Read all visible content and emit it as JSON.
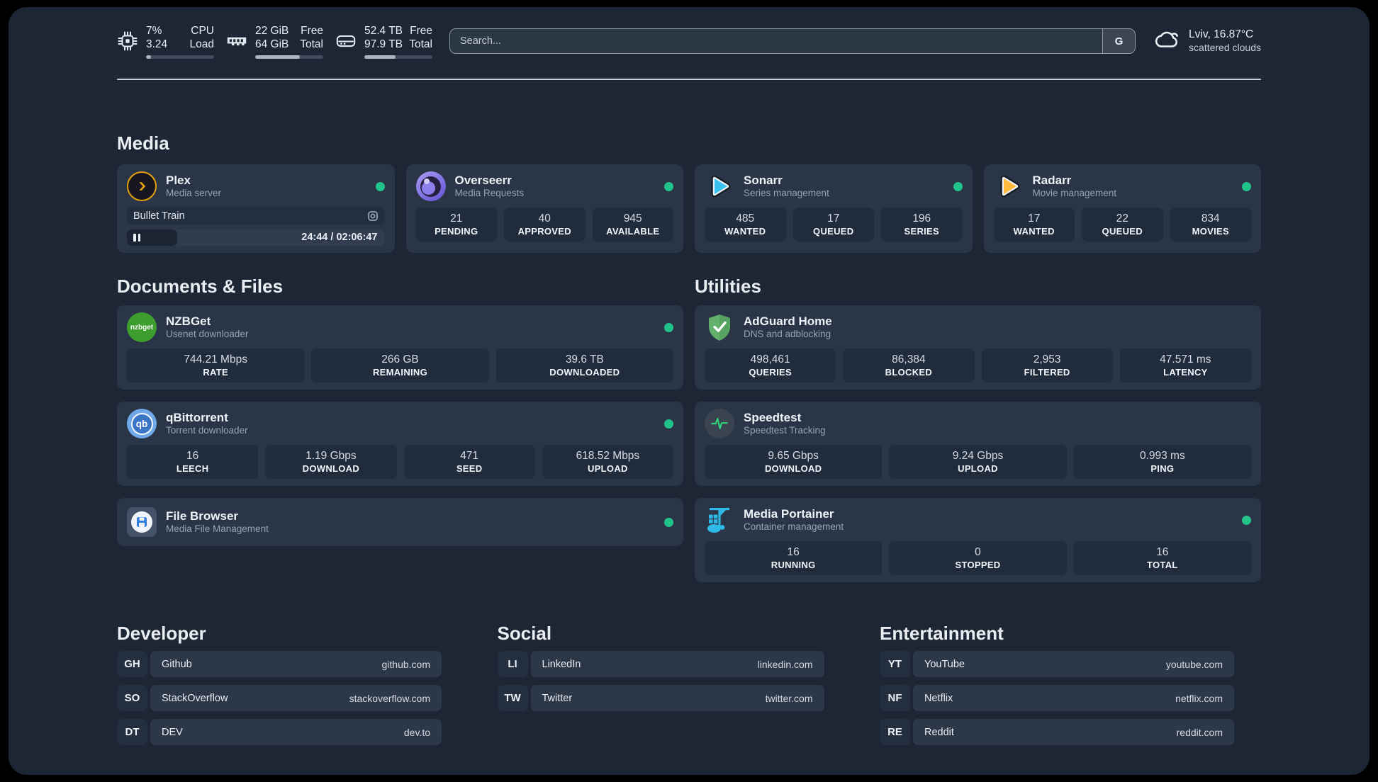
{
  "header": {
    "metrics": [
      {
        "name": "cpu",
        "icon": "cpu-icon",
        "rows": [
          [
            "7%",
            "CPU"
          ],
          [
            "3.24",
            "Load"
          ]
        ],
        "progress_pct": 7
      },
      {
        "name": "memory",
        "icon": "ram-icon",
        "rows": [
          [
            "22 GiB",
            "Free"
          ],
          [
            "64 GiB",
            "Total"
          ]
        ],
        "progress_pct": 66
      },
      {
        "name": "storage",
        "icon": "disk-icon",
        "rows": [
          [
            "52.4 TB",
            "Free"
          ],
          [
            "97.9 TB",
            "Total"
          ]
        ],
        "progress_pct": 46
      }
    ],
    "search": {
      "placeholder": "Search...",
      "engine_label": "G"
    },
    "weather": {
      "line1": "Lviv, 16.87°C",
      "line2": "scattered clouds"
    }
  },
  "sections": {
    "media": {
      "title": "Media"
    },
    "documents": {
      "title": "Documents & Files"
    },
    "utilities": {
      "title": "Utilities"
    },
    "developer": {
      "title": "Developer"
    },
    "social": {
      "title": "Social"
    },
    "entertainment": {
      "title": "Entertainment"
    }
  },
  "apps": {
    "plex": {
      "name": "Plex",
      "subtitle": "Media server",
      "online": true,
      "now_playing": {
        "title": "Bullet Train",
        "time": "24:44 / 02:06:47",
        "progress_pct": 19.5
      }
    },
    "overseerr": {
      "name": "Overseerr",
      "subtitle": "Media Requests",
      "online": true,
      "stats": [
        {
          "value": "21",
          "label": "PENDING"
        },
        {
          "value": "40",
          "label": "APPROVED"
        },
        {
          "value": "945",
          "label": "AVAILABLE"
        }
      ]
    },
    "sonarr": {
      "name": "Sonarr",
      "subtitle": "Series management",
      "online": true,
      "stats": [
        {
          "value": "485",
          "label": "WANTED"
        },
        {
          "value": "17",
          "label": "QUEUED"
        },
        {
          "value": "196",
          "label": "SERIES"
        }
      ]
    },
    "radarr": {
      "name": "Radarr",
      "subtitle": "Movie management",
      "online": true,
      "stats": [
        {
          "value": "17",
          "label": "WANTED"
        },
        {
          "value": "22",
          "label": "QUEUED"
        },
        {
          "value": "834",
          "label": "MOVIES"
        }
      ]
    },
    "nzbget": {
      "name": "NZBGet",
      "subtitle": "Usenet downloader",
      "online": true,
      "icon_text": "nzbget",
      "stats": [
        {
          "value": "744.21 Mbps",
          "label": "RATE"
        },
        {
          "value": "266 GB",
          "label": "REMAINING"
        },
        {
          "value": "39.6 TB",
          "label": "DOWNLOADED"
        }
      ]
    },
    "qbittorrent": {
      "name": "qBittorrent",
      "subtitle": "Torrent downloader",
      "online": true,
      "icon_text": "qb",
      "stats": [
        {
          "value": "16",
          "label": "LEECH"
        },
        {
          "value": "1.19 Gbps",
          "label": "DOWNLOAD"
        },
        {
          "value": "471",
          "label": "SEED"
        },
        {
          "value": "618.52 Mbps",
          "label": "UPLOAD"
        }
      ]
    },
    "filebrowser": {
      "name": "File Browser",
      "subtitle": "Media File Management",
      "online": true
    },
    "adguard": {
      "name": "AdGuard Home",
      "subtitle": "DNS and adblocking",
      "stats": [
        {
          "value": "498,461",
          "label": "QUERIES"
        },
        {
          "value": "86,384",
          "label": "BLOCKED"
        },
        {
          "value": "2,953",
          "label": "FILTERED"
        },
        {
          "value": "47.571 ms",
          "label": "LATENCY"
        }
      ]
    },
    "speedtest": {
      "name": "Speedtest",
      "subtitle": "Speedtest Tracking",
      "stats": [
        {
          "value": "9.65 Gbps",
          "label": "DOWNLOAD"
        },
        {
          "value": "9.24 Gbps",
          "label": "UPLOAD"
        },
        {
          "value": "0.993 ms",
          "label": "PING"
        }
      ]
    },
    "portainer": {
      "name": "Media Portainer",
      "subtitle": "Container management",
      "online": true,
      "stats": [
        {
          "value": "16",
          "label": "RUNNING"
        },
        {
          "value": "0",
          "label": "STOPPED"
        },
        {
          "value": "16",
          "label": "TOTAL"
        }
      ]
    }
  },
  "links": {
    "developer": [
      {
        "abbr": "GH",
        "name": "Github",
        "url": "github.com"
      },
      {
        "abbr": "SO",
        "name": "StackOverflow",
        "url": "stackoverflow.com"
      },
      {
        "abbr": "DT",
        "name": "DEV",
        "url": "dev.to"
      }
    ],
    "social": [
      {
        "abbr": "LI",
        "name": "LinkedIn",
        "url": "linkedin.com"
      },
      {
        "abbr": "TW",
        "name": "Twitter",
        "url": "twitter.com"
      }
    ],
    "entertainment": [
      {
        "abbr": "YT",
        "name": "YouTube",
        "url": "youtube.com"
      },
      {
        "abbr": "NF",
        "name": "Netflix",
        "url": "netflix.com"
      },
      {
        "abbr": "RE",
        "name": "Reddit",
        "url": "reddit.com"
      }
    ]
  },
  "colors": {
    "background": "#1c2634",
    "card": "#2a3547",
    "tile": "#202b3c",
    "status_online": "#22c38b",
    "plex_amber": "#e5a00d",
    "sonarr_blue": "#38c1ef",
    "radarr_yellow": "#ffb93c",
    "nzbget_green": "#3e9e2d",
    "qbittorrent_blue": "#3a76c4",
    "adguard_green": "#63b06c",
    "speedtest_pulse": "#31d27c",
    "portainer_blue": "#2fb9e8"
  }
}
